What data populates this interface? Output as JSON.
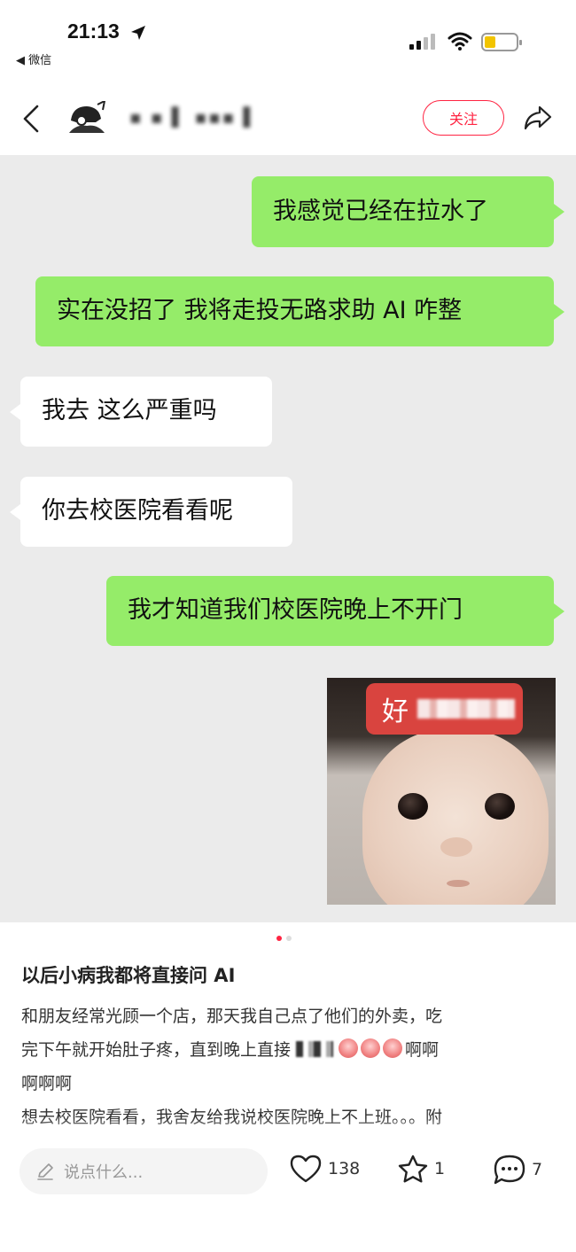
{
  "status_bar": {
    "time": "21:13",
    "back_app": "◀ 微信"
  },
  "nav": {
    "username": "▪ ▪  ▌ ▪▪▪ ▌",
    "follow_label": "关注"
  },
  "chat": {
    "messages": [
      {
        "side": "me",
        "text": "我感觉已经在拉水了"
      },
      {
        "side": "me",
        "text": "实在没招了 我将走投无路求助 AI 咋整"
      },
      {
        "side": "other",
        "text": "我去 这么严重吗"
      },
      {
        "side": "other",
        "text": "你去校医院看看呢"
      },
      {
        "side": "me",
        "text": "我才知道我们校医院晚上不开门"
      }
    ],
    "sticker_caption": "好"
  },
  "post": {
    "title": "以后小病我都将直接问 AI",
    "line1": "和朋友经常光顾一个店，那天我自己点了他们的外卖，吃",
    "line2_start": "完下午就开始肚子疼，直到晚上直接",
    "line2_end": "啊啊",
    "line3": "啊啊啊",
    "line4": "想去校医院看看，我舍友给我说校医院晚上不上班。。。附"
  },
  "bottom_bar": {
    "input_placeholder": "说点什么...",
    "likes": "138",
    "favorites": "1",
    "comments": "7"
  },
  "colors": {
    "accent_red": "#ff2442",
    "bubble_green": "#95ec69",
    "chat_bg": "#ebebeb"
  }
}
